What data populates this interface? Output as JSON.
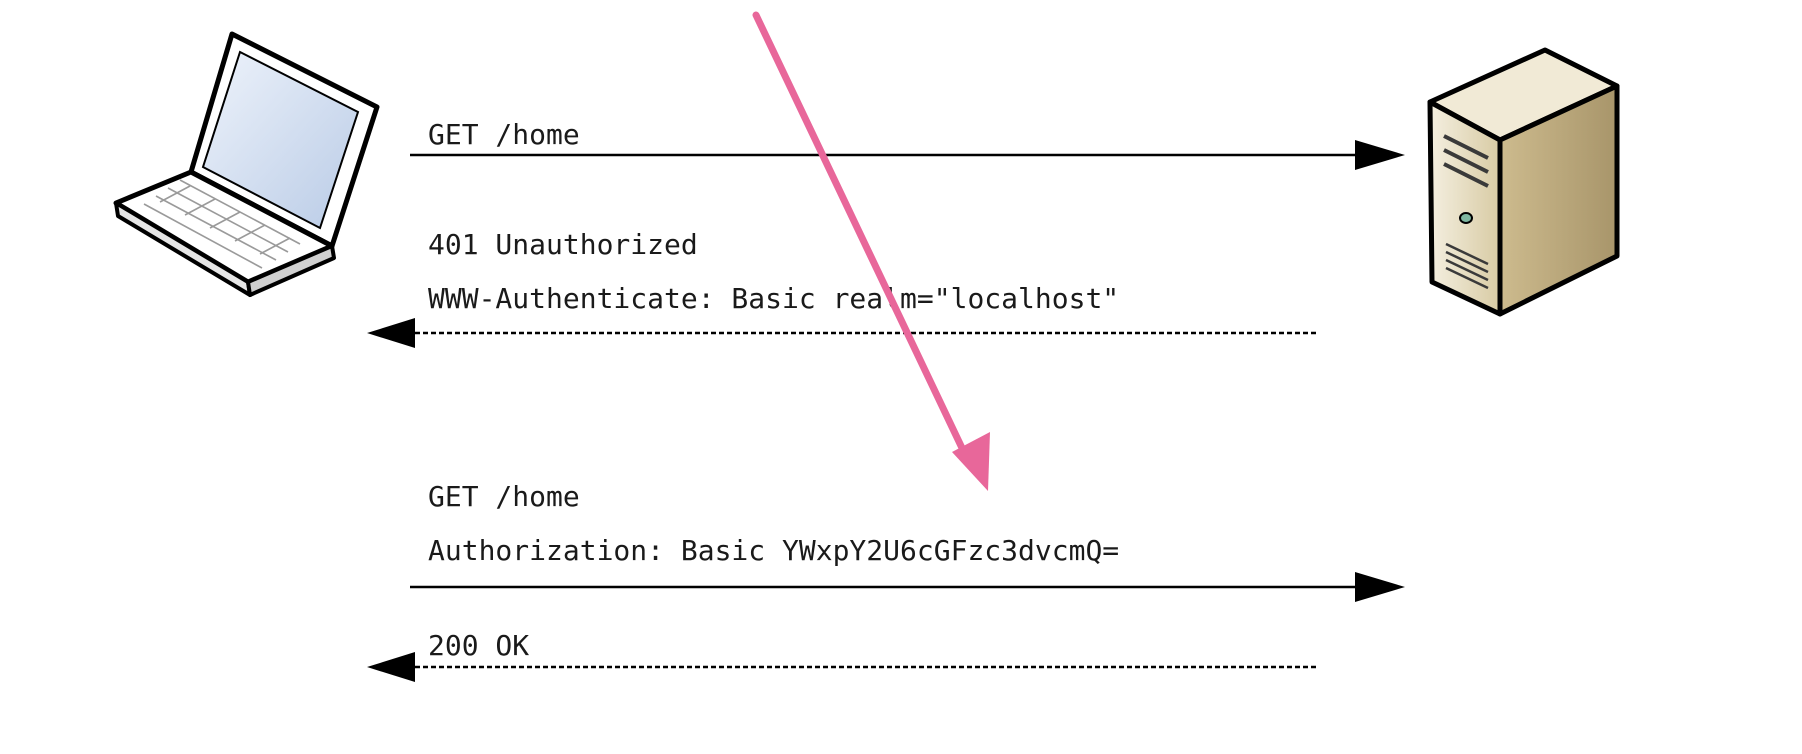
{
  "diagram": {
    "actors": {
      "client": {
        "icon": "laptop-icon"
      },
      "server": {
        "icon": "server-tower-icon"
      }
    },
    "messages": [
      {
        "direction": "client-to-server",
        "style": "solid",
        "lines": [
          "GET /home"
        ]
      },
      {
        "direction": "server-to-client",
        "style": "dashed",
        "lines": [
          "401 Unauthorized",
          "WWW-Authenticate: Basic realm=\"localhost\""
        ]
      },
      {
        "direction": "client-to-server",
        "style": "solid",
        "lines": [
          "GET /home",
          "Authorization: Basic YWxpY2U6cGFzc3dvcmQ="
        ]
      },
      {
        "direction": "server-to-client",
        "style": "dashed",
        "lines": [
          "200 OK"
        ]
      }
    ],
    "annotation": {
      "icon": "pointer-arrow-icon",
      "color": "#e8679a"
    },
    "colors": {
      "line": "#000000",
      "text": "#1a1a1a",
      "laptop_screen": "#d6e2f2",
      "server_body": "#e6dcc0",
      "accent": "#e8679a"
    }
  }
}
